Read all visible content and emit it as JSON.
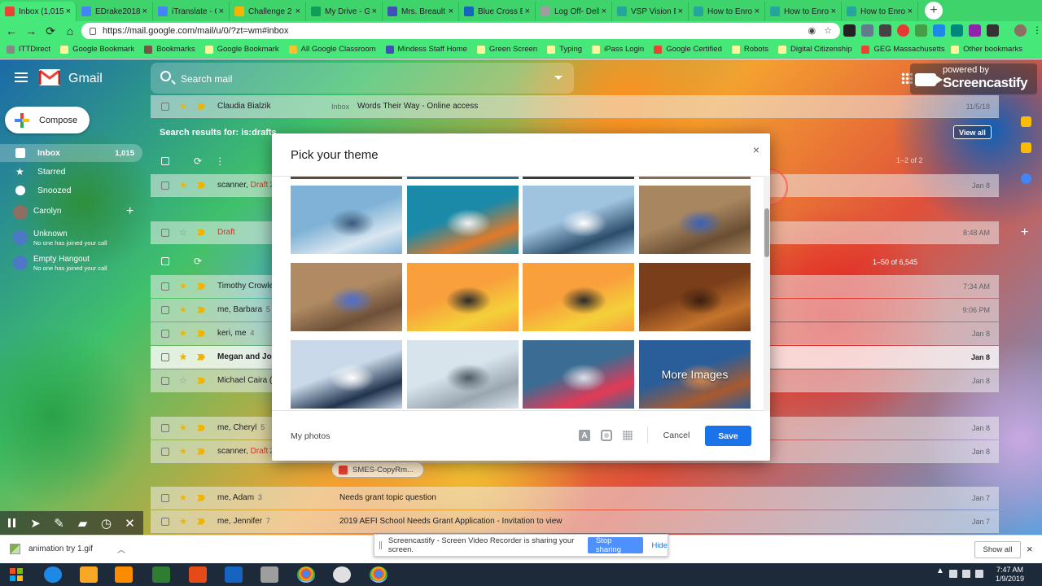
{
  "browser": {
    "tabs": [
      {
        "title": "Inbox (1,015)",
        "favicon": "gmail-icon",
        "color": "#ea4335",
        "active": true
      },
      {
        "title": "EDrake2018",
        "favicon": "docs-icon",
        "color": "#4285f4"
      },
      {
        "title": "iTranslate - C",
        "favicon": "docs-icon",
        "color": "#4285f4"
      },
      {
        "title": "Challenge 2",
        "favicon": "slides-icon",
        "color": "#f4b400"
      },
      {
        "title": "My Drive - G",
        "favicon": "drive-icon",
        "color": "#0f9d58"
      },
      {
        "title": "Mrs. Breault",
        "favicon": "calendar-icon",
        "color": "#3f51b5"
      },
      {
        "title": "Blue Cross B",
        "favicon": "bluecross-icon",
        "color": "#1565c0"
      },
      {
        "title": "Log Off- Dell",
        "favicon": "page-icon",
        "color": "#9e9e9e"
      },
      {
        "title": "VSP Vision B",
        "favicon": "vsp-icon",
        "color": "#26a69a"
      },
      {
        "title": "How to Enro",
        "favicon": "howto-icon",
        "color": "#26a69a"
      },
      {
        "title": "How to Enro",
        "favicon": "howto-icon",
        "color": "#26a69a"
      },
      {
        "title": "How to Enro",
        "favicon": "howto-icon",
        "color": "#26a69a"
      }
    ],
    "new_tab": "+",
    "close_glyph": "×",
    "nav": {
      "back": "←",
      "forward": "→",
      "reload": "⟳",
      "home": "⌂"
    },
    "url": "https://mail.google.com/mail/u/0/?zt=wm#inbox",
    "bookmarks": [
      {
        "label": "ITTDirect",
        "color": "#888"
      },
      {
        "label": "Google Bookmark",
        "color": "#fff59d"
      },
      {
        "label": "Bookmarks",
        "color": "#795548"
      },
      {
        "label": "Google Bookmark",
        "color": "#fff59d"
      },
      {
        "label": "All Google Classroom",
        "color": "#fbc02d"
      },
      {
        "label": "Mindess Staff Home",
        "color": "#3f51b5"
      },
      {
        "label": "Green Screen",
        "color": "#fff59d"
      },
      {
        "label": "Typing",
        "color": "#fff59d"
      },
      {
        "label": "iPass Login",
        "color": "#fff59d"
      },
      {
        "label": "Google Certified",
        "color": "#ea4335"
      },
      {
        "label": "Robots",
        "color": "#fff59d"
      },
      {
        "label": "Digital Citizenship",
        "color": "#fff59d"
      },
      {
        "label": "GEG Massachusetts",
        "color": "#ea4335"
      }
    ],
    "other_bookmarks": "Other bookmarks"
  },
  "gmail": {
    "logo_text": "Gmail",
    "search_placeholder": "Search mail",
    "screencastify_sub": "powered by",
    "screencastify_main": "Screencastify",
    "compose": "Compose",
    "nav": [
      {
        "label": "Inbox",
        "count": "1,015",
        "selected": true,
        "icon": "inbox-icon"
      },
      {
        "label": "Starred",
        "count": "",
        "icon": "star-icon"
      },
      {
        "label": "Snoozed",
        "count": "",
        "icon": "clock-icon"
      }
    ],
    "hangouts_user": "Carolyn",
    "hangouts": [
      {
        "name": "Unknown",
        "status": "No one has joined your call"
      },
      {
        "name": "Empty Hangout",
        "status": "No one has joined your call"
      }
    ],
    "search_results_label": "Search results for: is:drafts",
    "view_all": "View all",
    "pager_drafts": "1–2 of 2",
    "pager_inbox": "1–50 of 6,545",
    "top_row": {
      "sender": "Claudia Bialzik",
      "label": "Inbox",
      "subject": "Words Their Way - Online access",
      "date": "11/5/18"
    },
    "draft_rows": [
      {
        "sender": "scanner,",
        "draft": "Draft",
        "count": "2",
        "subject": "",
        "date": "Jan 8"
      },
      {
        "sender": "",
        "draft": "Draft",
        "count": "",
        "subject": "",
        "date": "8:48 AM"
      }
    ],
    "inbox_rows": [
      {
        "sender": "Timothy Crowle",
        "draft": "",
        "count": "",
        "subject": "",
        "date": "7:34 AM"
      },
      {
        "sender": "me, Barbara",
        "draft": "",
        "count": "5",
        "subject": "",
        "date": "9:06 PM"
      },
      {
        "sender": "keri, me",
        "draft": "",
        "count": "4",
        "subject": "",
        "date": "Jan 8"
      },
      {
        "sender": "Megan and Josh",
        "draft": "",
        "count": "",
        "subject": "",
        "date": "Jan 8"
      },
      {
        "sender": "Michael Caira (v",
        "draft": "",
        "count": "",
        "subject": "",
        "date": "Jan 8"
      },
      {
        "sender": "me, Cheryl",
        "draft": "",
        "count": "5",
        "subject": "",
        "date": "Jan 8"
      },
      {
        "sender": "scanner,",
        "draft": "Draft",
        "count": "2",
        "subject": "",
        "date": "Jan 8"
      },
      {
        "sender": "me, Adam",
        "draft": "",
        "count": "3",
        "subject": "Needs grant topic question",
        "date": "Jan 7"
      },
      {
        "sender": "me, Jennifer",
        "draft": "",
        "count": "7",
        "subject": "2019 AEFI School Needs Grant Application - Invitation to view",
        "date": "Jan 7"
      }
    ],
    "attachment": "SMES-CopyRm..."
  },
  "theme_dialog": {
    "title": "Pick your theme",
    "close": "×",
    "thumbnails": [
      {
        "name": "sailboat-race",
        "colors": [
          "#7fb2d6",
          "#d9e6f0",
          "#3a5a7a"
        ]
      },
      {
        "name": "butterflyfish",
        "colors": [
          "#1b8aa8",
          "#e07a2a",
          "#f2f2f2"
        ]
      },
      {
        "name": "sailboat-spray",
        "colors": [
          "#9fc4e0",
          "#2c4d6c",
          "#ffffff"
        ]
      },
      {
        "name": "motocross-dust",
        "colors": [
          "#a88660",
          "#6a4e33",
          "#3a62b8"
        ]
      },
      {
        "name": "motocross-turn",
        "colors": [
          "#b08a62",
          "#6d5038",
          "#4c6fd0"
        ]
      },
      {
        "name": "sunset-boat-painting",
        "colors": [
          "#f9a03c",
          "#f4d03a",
          "#2a2a2a"
        ]
      },
      {
        "name": "sunset-boat-painting-2",
        "colors": [
          "#f9a03c",
          "#f4d03a",
          "#2a2a2a"
        ]
      },
      {
        "name": "autumn-leaves",
        "colors": [
          "#7a3e1a",
          "#c4742c",
          "#3a1e0e"
        ]
      },
      {
        "name": "catamarans",
        "colors": [
          "#c9d9ea",
          "#20344e",
          "#ffffff"
        ]
      },
      {
        "name": "sailboat-deck",
        "colors": [
          "#d8e4ec",
          "#9aa6b0",
          "#505a64"
        ]
      },
      {
        "name": "red-sailboat",
        "colors": [
          "#3b6c93",
          "#e23a55",
          "#d9e2ea"
        ]
      },
      {
        "name": "monument-valley",
        "colors": [
          "#2a5e9a",
          "#a85a30",
          "#e08a4a"
        ],
        "overlay": "More Images"
      }
    ],
    "my_photos": "My photos",
    "cancel": "Cancel",
    "save": "Save"
  },
  "share_bar": {
    "message": "Screencastify - Screen Video Recorder is sharing your screen.",
    "stop": "Stop sharing",
    "hide": "Hide"
  },
  "downloads": {
    "file": "animation try 1.gif",
    "show_all": "Show all",
    "close": "×"
  },
  "taskbar": {
    "time": "7:47 AM",
    "date": "1/9/2019"
  },
  "colors": {
    "accent": "#1a73e8",
    "draft_red": "#d93025",
    "important_yellow": "#f0b400"
  }
}
